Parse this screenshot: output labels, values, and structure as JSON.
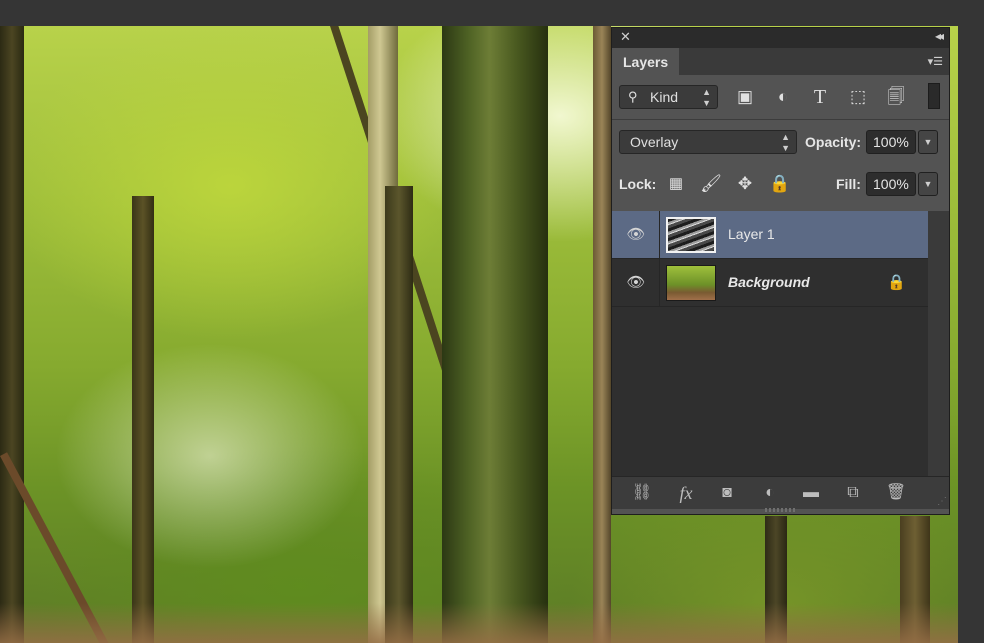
{
  "panel": {
    "tab_label": "Layers",
    "filter": {
      "label": "Kind"
    },
    "blend_mode": "Overlay",
    "opacity": {
      "label": "Opacity:",
      "value": "100%"
    },
    "lock": {
      "label": "Lock:"
    },
    "fill": {
      "label": "Fill:",
      "value": "100%"
    },
    "layers": [
      {
        "name": "Layer 1",
        "selected": true,
        "visible": true
      },
      {
        "name": "Background",
        "selected": false,
        "visible": true,
        "locked": true
      }
    ],
    "footer_icons": [
      "link-icon",
      "fx-icon",
      "mask-icon",
      "adjustment-icon",
      "folder-icon",
      "new-layer-icon",
      "trash-icon"
    ],
    "filter_icons": [
      "image-filter-icon",
      "adjustment-filter-icon",
      "type-filter-icon",
      "shape-filter-icon",
      "smart-object-filter-icon"
    ],
    "lock_icons": [
      "lock-pixels-icon",
      "lock-paint-icon",
      "lock-move-icon",
      "lock-all-icon"
    ]
  },
  "colors": {
    "panel_bg": "#535353",
    "selected_row": "#5c6a85",
    "app_bg": "#353535"
  }
}
